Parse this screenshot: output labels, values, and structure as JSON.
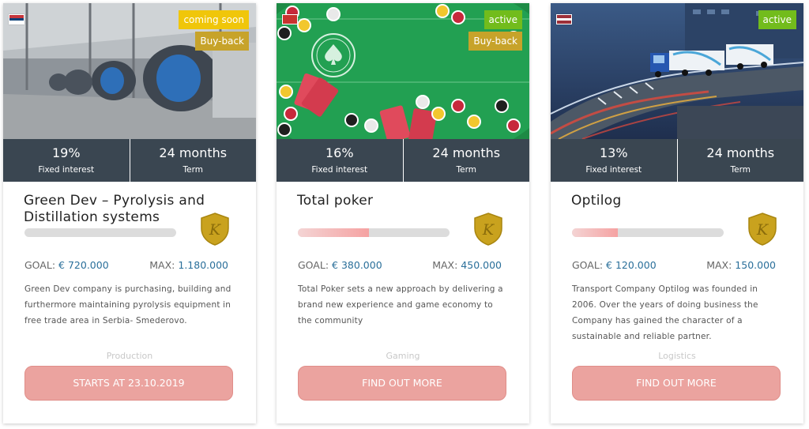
{
  "colors": {
    "stats_bar": "#3a4651",
    "cta_button": "#eba39f",
    "status_coming_soon": "#f0c60a",
    "status_active": "#72bc1c",
    "buyback": "#c7a32a",
    "value_link": "#2a6f9a"
  },
  "cards": [
    {
      "country_flag": "serbia-flag",
      "status": "coming soon",
      "buyback": "Buy-back",
      "interest_value": "19%",
      "interest_label": "Fixed interest",
      "term_value": "24 months",
      "term_label": "Term",
      "title": "Green Dev – Pyrolysis and Distillation systems",
      "progress": 0.0,
      "goal_label": "GOAL:",
      "goal_value": "€ 720.000",
      "max_label": "MAX:",
      "max_value": "1.180.000",
      "description": "Green Dev company is purchasing, building and furthermore maintaining pyrolysis equipment in free trade area in Serbia- Smederovo.",
      "category": "Production",
      "cta": "STARTS AT 23.10.2019",
      "shield_icon": "k-shield-icon"
    },
    {
      "country_flag": "red-flag",
      "status": "active",
      "buyback": "Buy-back",
      "interest_value": "16%",
      "interest_label": "Fixed interest",
      "term_value": "24 months",
      "term_label": "Term",
      "title": "Total poker",
      "progress": 0.47,
      "goal_label": "GOAL:",
      "goal_value": "€ 380.000",
      "max_label": "MAX:",
      "max_value": "450.000",
      "description": "Total Poker sets a new approach by delivering a brand new experience and game economy to the community",
      "category": "Gaming",
      "cta": "FIND OUT MORE",
      "shield_icon": "k-shield-icon"
    },
    {
      "country_flag": "latvia-flag",
      "status": "active",
      "buyback": "",
      "interest_value": "13%",
      "interest_label": "Fixed interest",
      "term_value": "24 months",
      "term_label": "Term",
      "title": "Optilog",
      "progress": 0.3,
      "goal_label": "GOAL:",
      "goal_value": "€ 120.000",
      "max_label": "MAX:",
      "max_value": "150.000",
      "description": "Transport Company Optilog was founded in 2006. Over the years of doing business the Company has gained the character of a sustainable and reliable partner.",
      "category": "Logistics",
      "cta": "FIND OUT MORE",
      "shield_icon": "k-shield-icon"
    }
  ]
}
